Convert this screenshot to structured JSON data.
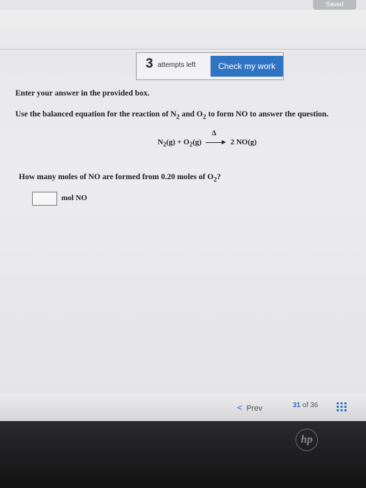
{
  "status": {
    "saved": "Saved"
  },
  "attempts": {
    "count": "3",
    "label": "attempts left"
  },
  "toolbar": {
    "check_label": "Check my work"
  },
  "problem": {
    "instruction": "Enter your answer in the provided box.",
    "question_pre": "Use the balanced equation for the reaction of N",
    "question_sub1": "2",
    "question_mid1": " and O",
    "question_sub2": "2",
    "question_post": " to form NO to answer the question.",
    "equation": {
      "r1": "N",
      "r1_sub": "2",
      "r1_state": "(g) + O",
      "r2_sub": "2",
      "r2_state": "(g)",
      "condition": "Δ",
      "product": "2 NO(g)"
    },
    "question2_pre": "How many moles of NO are formed from 0.20 moles of O",
    "question2_sub": "2",
    "question2_post": "?",
    "answer_value": "",
    "unit": "mol NO"
  },
  "footer": {
    "prev_label": "Prev",
    "prev_chevron": "<",
    "current_page": "31",
    "of_label": "of",
    "total_pages": "36"
  },
  "icons": {
    "prev": "chevron-left-icon",
    "grid": "grid-icon",
    "logo": "hp-logo"
  },
  "brand": {
    "logo_text": "hp"
  },
  "colors": {
    "accent": "#2f74c2"
  }
}
